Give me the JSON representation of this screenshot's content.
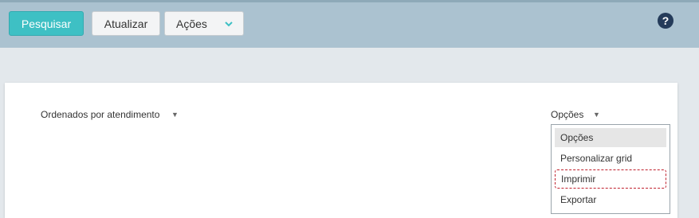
{
  "toolbar": {
    "search_label": "Pesquisar",
    "refresh_label": "Atualizar",
    "actions_label": "Ações",
    "help_label": "?"
  },
  "grid": {
    "sort_label": "Ordenados por atendimento",
    "options_label": "Opções",
    "options_menu": [
      {
        "label": "Opções",
        "selected": true
      },
      {
        "label": "Personalizar grid",
        "selected": false
      },
      {
        "label": "Imprimir",
        "selected": false,
        "highlighted": true
      },
      {
        "label": "Exportar",
        "selected": false
      }
    ]
  },
  "colors": {
    "primary": "#3ec0c4",
    "toolbar_bg": "#abc2d0",
    "highlight": "#c0212e"
  },
  "icons": {
    "actions_chevron": "chevron-down-icon",
    "help": "help-icon",
    "sort_dropdown": "caret-down-icon",
    "options_dropdown": "caret-down-icon"
  }
}
